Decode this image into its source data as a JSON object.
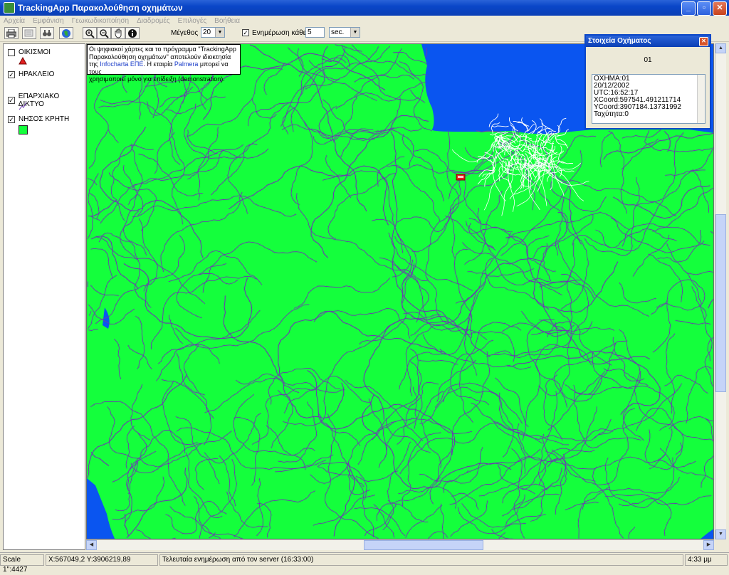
{
  "window": {
    "title": "TrackingApp Παρακολούθηση οχημάτων"
  },
  "menu": [
    {
      "label": "Αρχεία"
    },
    {
      "label": "Εμφάνιση"
    },
    {
      "label": "Γεωκωδικοποίηση"
    },
    {
      "label": "Διαδρομές"
    },
    {
      "label": "Επιλογές"
    },
    {
      "label": "Βοήθεια"
    }
  ],
  "toolbar": {
    "size_label": "Μέγεθος",
    "size_value": "20",
    "update_label": "Ενημέρωση κάθε",
    "update_checked": true,
    "interval_value": "5",
    "unit_value": "sec.",
    "icons": [
      "print-icon",
      "layers-icon",
      "binoculars-icon",
      "globe-icon",
      "zoom-in-icon",
      "zoom-out-icon",
      "pan-hand-icon",
      "info-icon"
    ]
  },
  "layers": [
    {
      "label": "ΟΙΚΙΣΜΟΙ",
      "checked": false,
      "symbol": "red-triangle"
    },
    {
      "label": "ΗΡΑΚΛΕΙΟ",
      "checked": true,
      "symbol": "none"
    },
    {
      "label": "ΕΠΑΡΧΙΑΚΟ ΔΙΚΤΥΟ",
      "checked": true,
      "symbol": "road-line"
    },
    {
      "label": "ΝΗΣΟΣ ΚΡΗΤΗ",
      "checked": true,
      "symbol": "green-square"
    }
  ],
  "copyright": {
    "line1": "Οι ψηφιακοί χάρτες και το πρόγραμμα ''TrackingApp",
    "line2": "Παρακολούθηση οχημάτων'' αποτελούν ιδιοκτησία",
    "line3_pre": "της ",
    "line3_link1": "Infocharta ΕΠΕ",
    "line3_mid": ". Η εταιρία ",
    "line3_link2": "Palmera",
    "line3_post": " μπορεί να τους",
    "line4": "χρησιμοποιεί μόνο για επίδειξη (demonstration)."
  },
  "vehicle_info": {
    "title": "Στοιχεία Οχήματος",
    "id": "01",
    "rows": [
      "ΟΧΗΜΑ:01",
      "20/12/2002",
      "UTC:16:52:17",
      "XCoord:597541.491211714",
      "YCoord:3907184.13731992",
      "Ταχύτητα:0"
    ]
  },
  "status": {
    "scale": "Scale 1'':4427",
    "coords": "X:567049,2 Y:3906219,89",
    "message": "Τελευταία ενημέρωση από τον server (16:33:00)",
    "time": "4:33 μμ"
  },
  "colors": {
    "land": "#14ff3c",
    "sea": "#0a55f0",
    "roads": "#6a3bb0",
    "city": "#ffffff",
    "accent": "#0a46c8"
  }
}
